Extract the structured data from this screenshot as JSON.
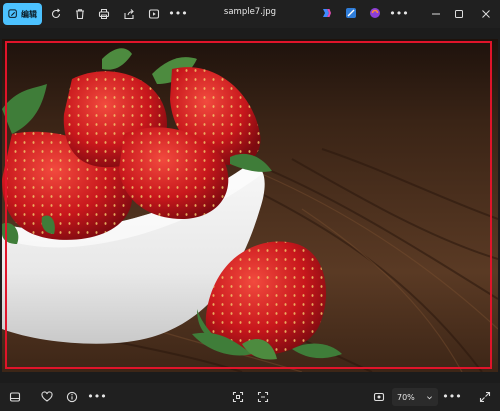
{
  "toolbar": {
    "edit_label": "编辑",
    "more_label": "•••"
  },
  "window": {
    "filename": "sample7.jpg",
    "more_label": "•••"
  },
  "footer": {
    "more_label": "•••",
    "zoom_value": "70%",
    "zoom_more_label": "•••"
  },
  "colors": {
    "accent": "#4cc2ff",
    "selection_frame": "#e0142a",
    "background": "#1c1c1c",
    "bar": "#202020"
  }
}
